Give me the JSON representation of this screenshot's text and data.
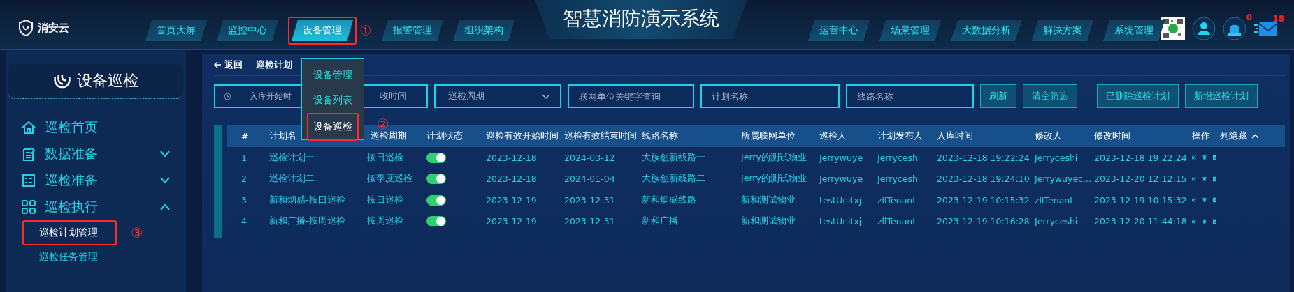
{
  "header": {
    "logo": "消安云",
    "title": "智慧消防演示系统",
    "nav_left": [
      {
        "label": "首页大屏",
        "selected": false
      },
      {
        "label": "监控中心",
        "selected": false
      },
      {
        "label": "设备管理",
        "selected": true,
        "annotation": "①"
      },
      {
        "label": "报警管理",
        "selected": false
      },
      {
        "label": "组织架构",
        "selected": false
      }
    ],
    "nav_right": [
      {
        "label": "运营中心",
        "selected": false
      },
      {
        "label": "场景管理",
        "selected": false
      },
      {
        "label": "大数据分析",
        "selected": false
      },
      {
        "label": "解决方案",
        "selected": false
      },
      {
        "label": "系统管理",
        "selected": false
      }
    ],
    "alarm_count": "0",
    "message_count": "18"
  },
  "dropdown": {
    "items": [
      {
        "label": "设备管理",
        "selected": false
      },
      {
        "label": "设备列表",
        "selected": false
      },
      {
        "label": "设备巡检",
        "selected": true,
        "annotation": "②"
      }
    ]
  },
  "sidebar": {
    "title": "设备巡检",
    "items": [
      {
        "label": "巡检首页"
      },
      {
        "label": "数据准备",
        "expanded": false
      },
      {
        "label": "巡检准备",
        "expanded": false
      },
      {
        "label": "巡检执行",
        "expanded": true,
        "children": [
          {
            "label": "巡检计划管理",
            "selected": true,
            "annotation": "③"
          },
          {
            "label": "巡检任务管理",
            "selected": false
          }
        ]
      }
    ]
  },
  "breadcrumb": {
    "back": "返回",
    "current": "巡检计划"
  },
  "filters": [
    {
      "kind": "date-range",
      "start_placeholder": "入库开始时",
      "end_placeholder": "收时间"
    },
    {
      "kind": "select",
      "placeholder": "巡检周期"
    },
    {
      "kind": "text",
      "placeholder": "联网单位关键字查询"
    },
    {
      "kind": "text",
      "placeholder": "计划名称"
    },
    {
      "kind": "text",
      "placeholder": "线路名称"
    }
  ],
  "buttons": [
    "刷新",
    "清空筛选",
    "已删除巡检计划",
    "新增巡检计划"
  ],
  "table": {
    "columns": [
      "#",
      "计划名",
      "巡检周期",
      "计划状态",
      "巡检有效开始时间",
      "巡检有效结束时间",
      "线路名称",
      "所属联网单位",
      "巡检人",
      "计划发布人",
      "入库时间",
      "修改人",
      "修改时间",
      "操作"
    ],
    "column_toggle": "列隐藏",
    "rows": [
      {
        "no": "1",
        "name": "巡检计划一",
        "cycle": "按日巡检",
        "enabled": true,
        "start": "2023-12-18",
        "end": "2024-03-12",
        "route": "大族创新线路一",
        "unit": "Jerry的测试物业",
        "inspector": "Jerrywuye",
        "publisher": "Jerryceshi",
        "created": "2023-12-18 19:22:24",
        "modifier": "Jerryceshi",
        "modified": "2023-12-18 19:22:24"
      },
      {
        "no": "2",
        "name": "巡检计划二",
        "cycle": "按季度巡检",
        "enabled": true,
        "start": "2023-12-18",
        "end": "2024-01-04",
        "route": "大族创新线路二",
        "unit": "Jerry的测试物业",
        "inspector": "Jerrywuye",
        "publisher": "Jerryceshi",
        "created": "2023-12-18 19:24:10",
        "modifier": "Jerrywuyec...",
        "modified": "2023-12-20 12:12:15"
      },
      {
        "no": "3",
        "name": "新和烟感-按日巡检",
        "cycle": "按日巡检",
        "enabled": true,
        "start": "2023-12-19",
        "end": "2023-12-31",
        "route": "新和烟感线路",
        "unit": "新和测试物业",
        "inspector": "testUnitxj",
        "publisher": "zllTenant",
        "created": "2023-12-19 10:15:32",
        "modifier": "zllTenant",
        "modified": "2023-12-19 10:15:32"
      },
      {
        "no": "4",
        "name": "新和广播-按周巡检",
        "cycle": "按周巡检",
        "enabled": true,
        "start": "2023-12-19",
        "end": "2023-12-31",
        "route": "新和广播",
        "unit": "新和测试物业",
        "inspector": "testUnitxj",
        "publisher": "zllTenant",
        "created": "2023-12-19 10:16:28",
        "modifier": "Jerryceshi",
        "modified": "2023-12-20 11:44:18"
      }
    ]
  }
}
